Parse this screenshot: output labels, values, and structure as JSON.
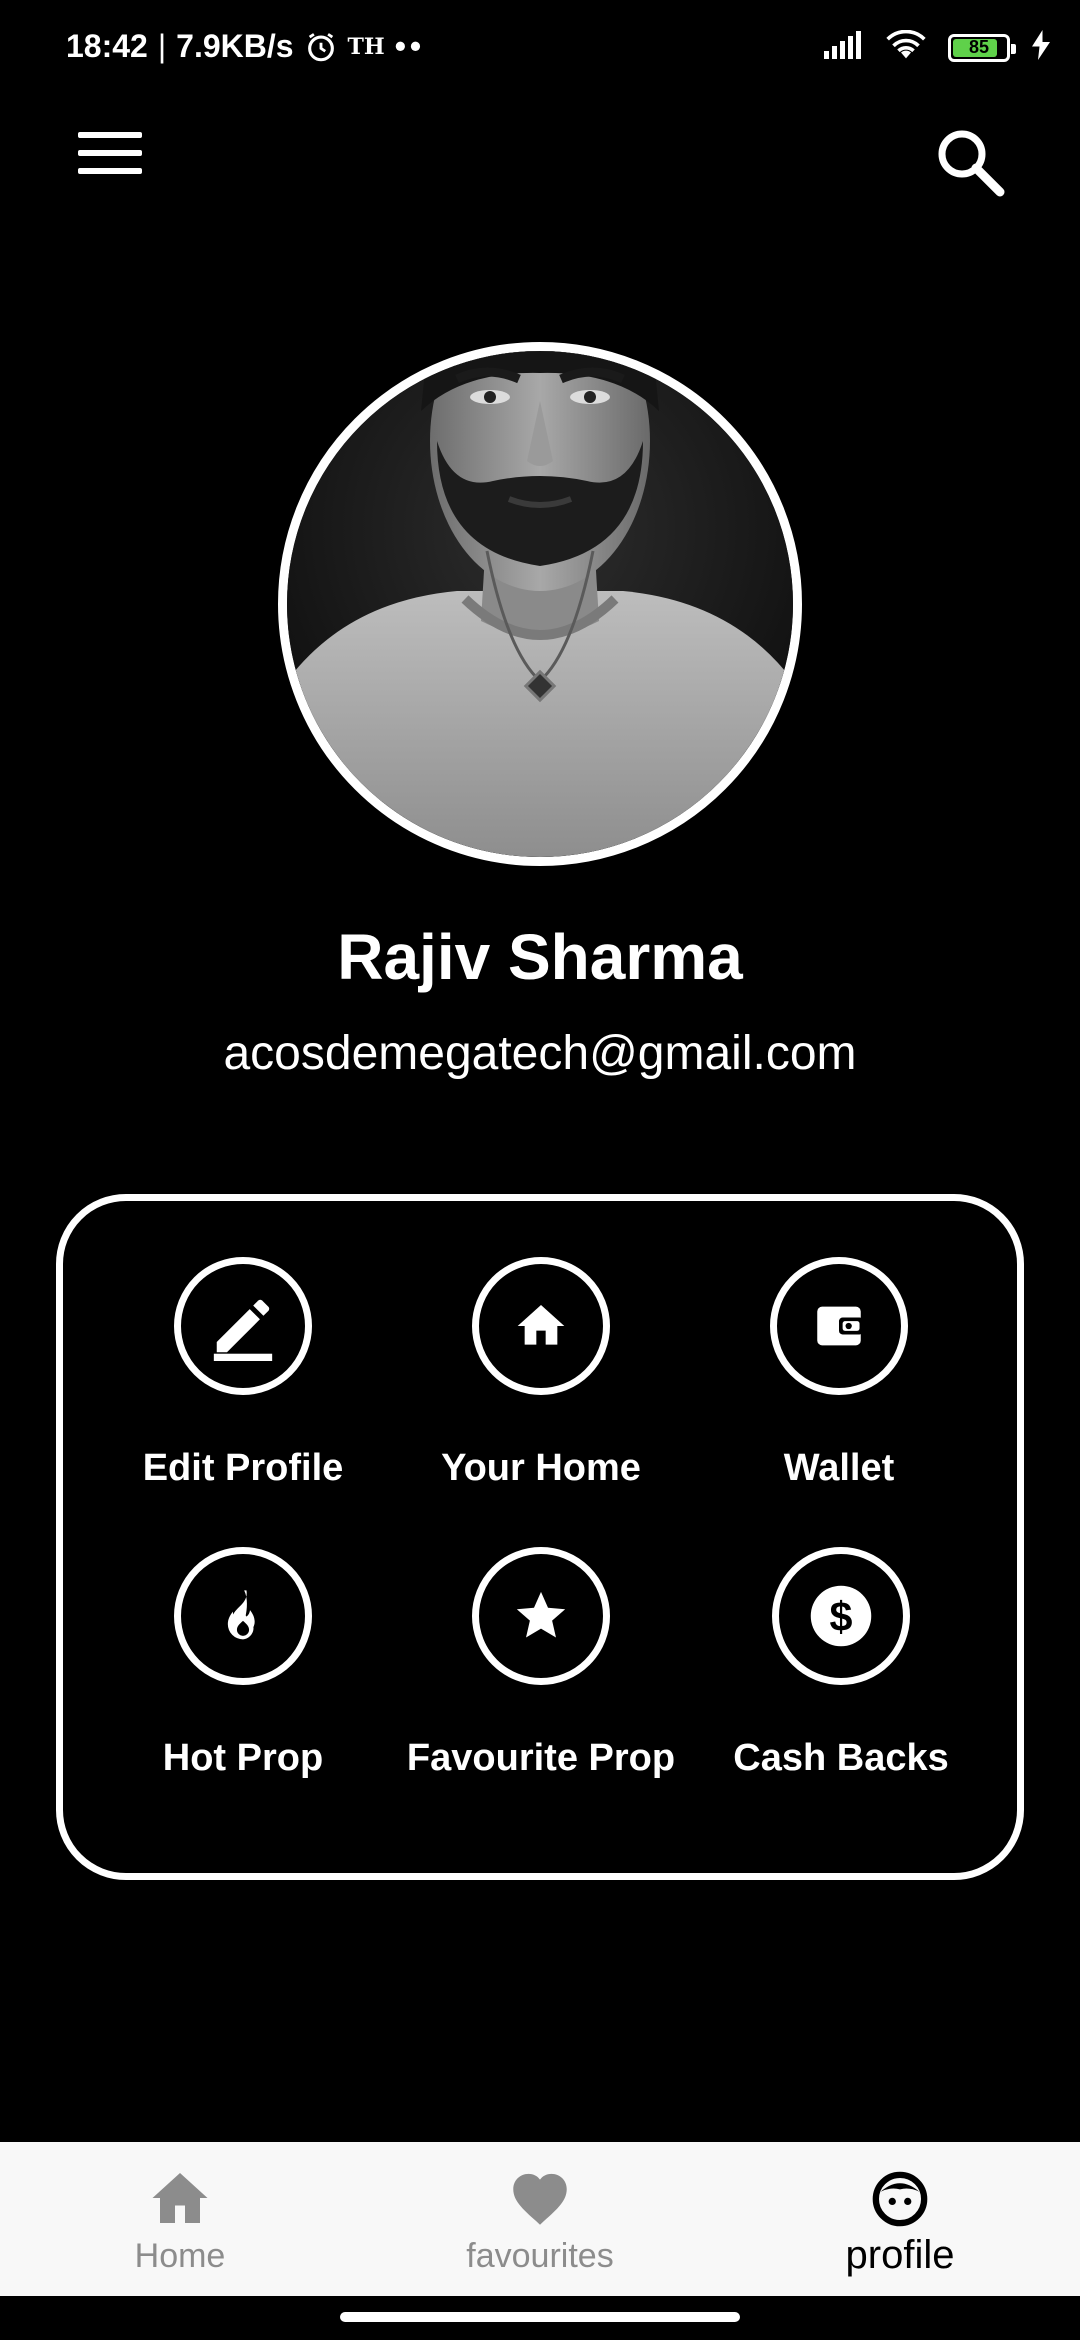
{
  "status_bar": {
    "time": "18:42",
    "separator": "|",
    "speed": "7.9KB/s",
    "carrier_badge": "TH",
    "more_dots": "••",
    "battery_level": "85",
    "battery_fraction": 0.85,
    "icons": [
      "alarm-icon",
      "signal-icon",
      "wifi-icon",
      "battery-icon",
      "charging-icon"
    ]
  },
  "app_bar": {
    "icons": [
      "menu-icon",
      "search-icon"
    ]
  },
  "profile": {
    "name": "Rajiv Sharma",
    "email": "acosdemegatech@gmail.com"
  },
  "actions": [
    {
      "label": "Edit Profile",
      "icon": "edit-icon"
    },
    {
      "label": "Your Home",
      "icon": "home-icon"
    },
    {
      "label": "Wallet",
      "icon": "wallet-icon"
    },
    {
      "label": "Hot Prop",
      "icon": "fire-icon"
    },
    {
      "label": "Favourite Prop",
      "icon": "star-icon"
    },
    {
      "label": "Cash Backs",
      "icon": "dollar-icon"
    }
  ],
  "bottom_nav": {
    "items": [
      {
        "label": "Home",
        "icon": "home-icon",
        "active": false
      },
      {
        "label": "favourites",
        "icon": "heart-icon",
        "active": false
      },
      {
        "label": "profile",
        "icon": "face-icon",
        "active": true
      }
    ]
  },
  "colors": {
    "background": "#000000",
    "foreground": "#ffffff",
    "nav_background": "#f8f8f8",
    "nav_inactive": "#8c8c8c",
    "battery_fill": "#5fd14a"
  }
}
